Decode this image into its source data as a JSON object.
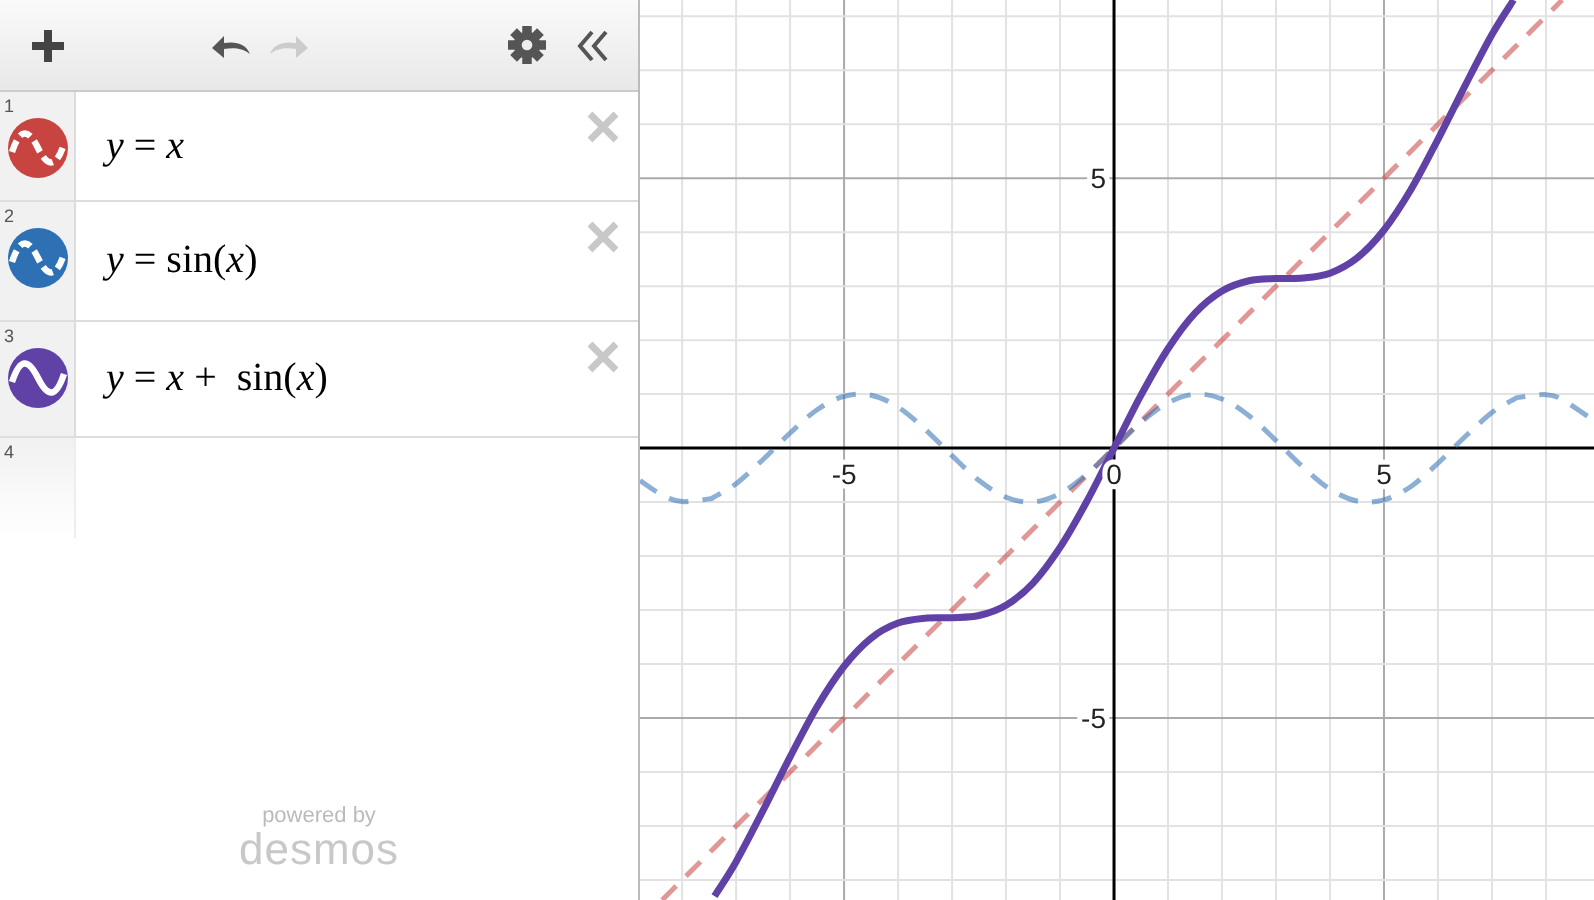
{
  "toolbar": {
    "undo": {
      "disabled": false
    },
    "redo": {
      "disabled": true
    }
  },
  "expressions": [
    {
      "number": "1",
      "latex": "*y* = *x*",
      "color": "#c74440",
      "dashed": true
    },
    {
      "number": "2",
      "latex": "*y* = sin(*x*)",
      "color": "#2d70b3",
      "dashed": true
    },
    {
      "number": "3",
      "latex": "*y* = *x* +  sin(*x*)",
      "color": "#6042a6",
      "dashed": false
    },
    {
      "number": "4"
    }
  ],
  "branding": {
    "tagline": "powered by",
    "logo": "desmos"
  },
  "graph": {
    "chart_data": {
      "type": "line",
      "grid": true,
      "xlim": [
        -8.78,
        8.89
      ],
      "ylim": [
        -8.37,
        8.3
      ],
      "xticks": [
        {
          "value": -5,
          "label": "-5"
        },
        {
          "value": 0,
          "label": "0"
        },
        {
          "value": 5,
          "label": "5"
        }
      ],
      "yticks": [
        {
          "value": -5,
          "label": "-5"
        },
        {
          "value": 5,
          "label": "5"
        }
      ],
      "x": [
        -8.78,
        -8.37,
        -8,
        -7.5,
        -7.4,
        -7,
        -6.5,
        -6,
        -5.5,
        -5,
        -4.5,
        -4,
        -3.5,
        -3,
        -2.5,
        -2,
        -1.5,
        -1,
        -0.5,
        0,
        0.5,
        1,
        1.5,
        2,
        2.5,
        3,
        3.5,
        4,
        4.5,
        5,
        5.5,
        6,
        6.5,
        7,
        7.4,
        7.5,
        8,
        8.3,
        8.89
      ],
      "series": [
        {
          "color": "#c74440",
          "line_style": "dashed",
          "values": [
            null,
            -8.37,
            -8,
            -7.5,
            -7.4,
            -7,
            -6.5,
            -6,
            -5.5,
            -5,
            -4.5,
            -4,
            -3.5,
            -3,
            -2.5,
            -2,
            -1.5,
            -1,
            -0.5,
            0,
            0.5,
            1,
            1.5,
            2,
            2.5,
            3,
            3.5,
            4,
            4.5,
            5,
            5.5,
            6,
            6.5,
            7,
            7.4,
            7.5,
            8,
            8.3,
            null
          ]
        },
        {
          "color": "#2d70b3",
          "line_style": "dashed",
          "values": [
            -0.6,
            -0.87,
            -0.99,
            -0.94,
            -0.9,
            -0.66,
            -0.21,
            0.28,
            0.71,
            0.96,
            0.98,
            0.76,
            0.35,
            -0.14,
            -0.6,
            -0.91,
            -1,
            -0.84,
            -0.48,
            0,
            0.48,
            0.84,
            1,
            0.91,
            0.6,
            0.14,
            -0.35,
            -0.76,
            -0.98,
            -0.96,
            -0.71,
            -0.28,
            0.21,
            0.66,
            0.9,
            0.94,
            0.99,
            0.9,
            0.51
          ]
        },
        {
          "color": "#6042a6",
          "line_style": "solid",
          "values": [
            null,
            null,
            null,
            null,
            -8.3,
            -7.66,
            -6.71,
            -5.72,
            -4.79,
            -4.04,
            -3.52,
            -3.24,
            -3.15,
            -3.14,
            -3.1,
            -2.91,
            -2.5,
            -1.84,
            -0.98,
            0,
            0.98,
            1.84,
            2.5,
            2.91,
            3.1,
            3.14,
            3.15,
            3.24,
            3.52,
            4.04,
            4.79,
            5.72,
            6.71,
            7.66,
            8.3,
            null,
            null,
            null,
            null
          ]
        }
      ]
    }
  }
}
